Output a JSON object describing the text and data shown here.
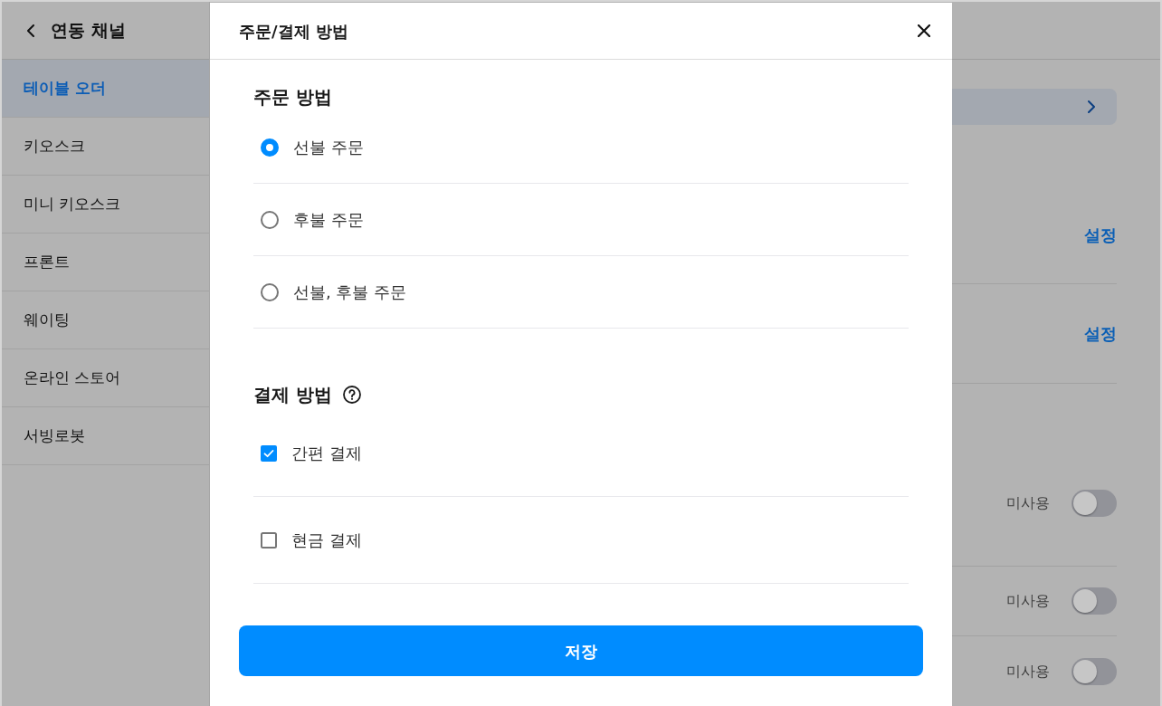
{
  "sidebar": {
    "title": "연동 채널",
    "items": [
      {
        "label": "테이블 오더",
        "selected": true
      },
      {
        "label": "키오스크",
        "selected": false
      },
      {
        "label": "미니 키오스크",
        "selected": false
      },
      {
        "label": "프론트",
        "selected": false
      },
      {
        "label": "웨이팅",
        "selected": false
      },
      {
        "label": "온라인 스토어",
        "selected": false
      },
      {
        "label": "서빙로봇",
        "selected": false
      }
    ]
  },
  "settings_rows": [
    {
      "kind": "link"
    },
    {
      "kind": "action",
      "action": "설정"
    },
    {
      "kind": "action",
      "action": "설정"
    },
    {
      "kind": "toggle",
      "status": "미사용",
      "on": false
    },
    {
      "kind": "toggle",
      "status": "미사용",
      "on": false
    },
    {
      "kind": "toggle",
      "status": "미사용",
      "on": false
    }
  ],
  "dialog": {
    "title": "주문/결제 방법",
    "sections": [
      {
        "kind": "radio",
        "heading": "주문 방법",
        "help": false,
        "options": [
          {
            "label": "선불 주문",
            "selected": true
          },
          {
            "label": "후불 주문",
            "selected": false
          },
          {
            "label": "선불, 후불 주문",
            "selected": false
          }
        ]
      },
      {
        "kind": "checkbox",
        "heading": "결제 방법",
        "help": true,
        "options": [
          {
            "label": "간편 결제",
            "checked": true
          },
          {
            "label": "현금 결제",
            "checked": false
          }
        ]
      }
    ],
    "save_button": "저장"
  }
}
